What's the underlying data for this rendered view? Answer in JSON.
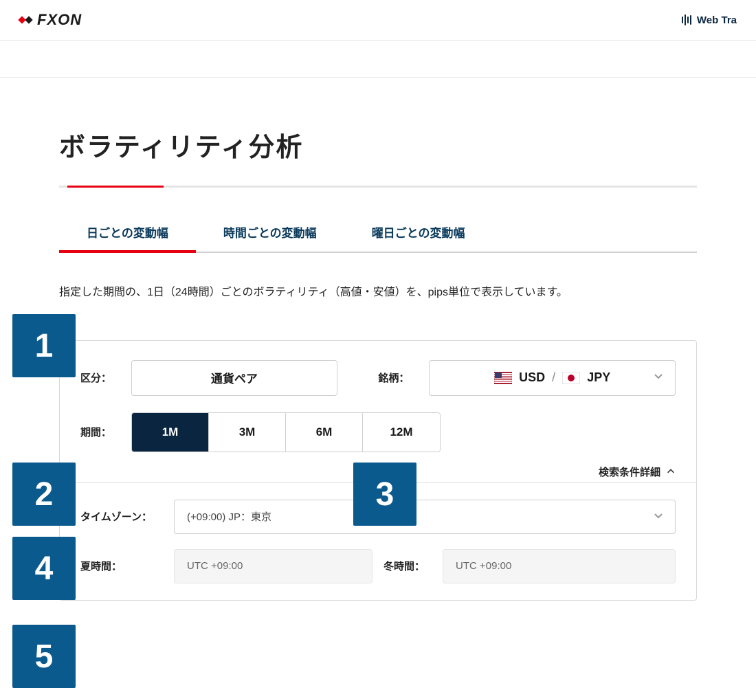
{
  "header": {
    "brand": "FXON",
    "webtrade_label": "Web Tra"
  },
  "page": {
    "title": "ボラティリティ分析",
    "description": "指定した期間の、1日（24時間）ごとのボラティリティ（高値・安値）を、pips単位で表示しています。"
  },
  "tabs": [
    {
      "label": "日ごとの変動幅",
      "active": true
    },
    {
      "label": "時間ごとの変動幅",
      "active": false
    },
    {
      "label": "曜日ごとの変動幅",
      "active": false
    }
  ],
  "panel": {
    "category_label": "区分：",
    "category_value": "通貨ペア",
    "symbol_label": "銘柄：",
    "symbol_base": "USD",
    "symbol_quote": "JPY",
    "period_label": "期間：",
    "periods": [
      "1M",
      "3M",
      "6M",
      "12M"
    ],
    "period_active": "1M",
    "details_label": "検索条件詳細",
    "timezone_label": "タイムゾーン：",
    "timezone_value": "(+09:00) JP：東京",
    "summer_label": "夏時間：",
    "summer_value": "UTC +09:00",
    "winter_label": "冬時間：",
    "winter_value": "UTC +09:00"
  },
  "badges": {
    "b1": "1",
    "b2": "2",
    "b3": "3",
    "b4": "4",
    "b5": "5"
  }
}
